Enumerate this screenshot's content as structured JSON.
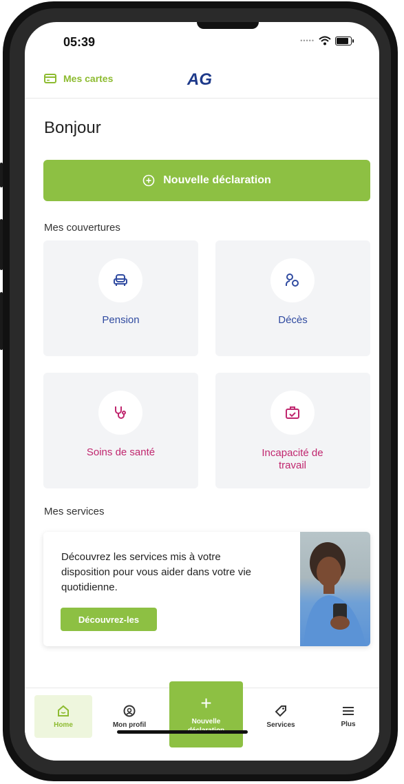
{
  "status": {
    "time": "05:39"
  },
  "header": {
    "cards_label": "Mes cartes",
    "logo_text": "AG"
  },
  "greeting": "Bonjour",
  "cta": {
    "label": "Nouvelle déclaration"
  },
  "coverages": {
    "title": "Mes couvertures",
    "items": [
      {
        "label": "Pension",
        "icon": "armchair-icon",
        "color": "#2f4aa0"
      },
      {
        "label": "Décès",
        "icon": "user-lines-icon",
        "color": "#2f4aa0"
      },
      {
        "label": "Soins de santé",
        "icon": "stethoscope-icon",
        "color": "#c0266e"
      },
      {
        "label": "Incapacité de travail",
        "icon": "suitcase-check-icon",
        "color": "#c0266e"
      }
    ]
  },
  "services": {
    "title": "Mes services",
    "text": "Découvrez les services mis à votre disposition pour vous aider dans votre vie quotidienne.",
    "button": "Découvrez-les"
  },
  "tabbar": {
    "home": "Home",
    "profile": "Mon profil",
    "new_decl": "Nouvelle déclaration",
    "services": "Services",
    "more": "Plus"
  },
  "colors": {
    "accent": "#8dc043",
    "blue": "#2f4aa0",
    "magenta": "#c0266e"
  }
}
